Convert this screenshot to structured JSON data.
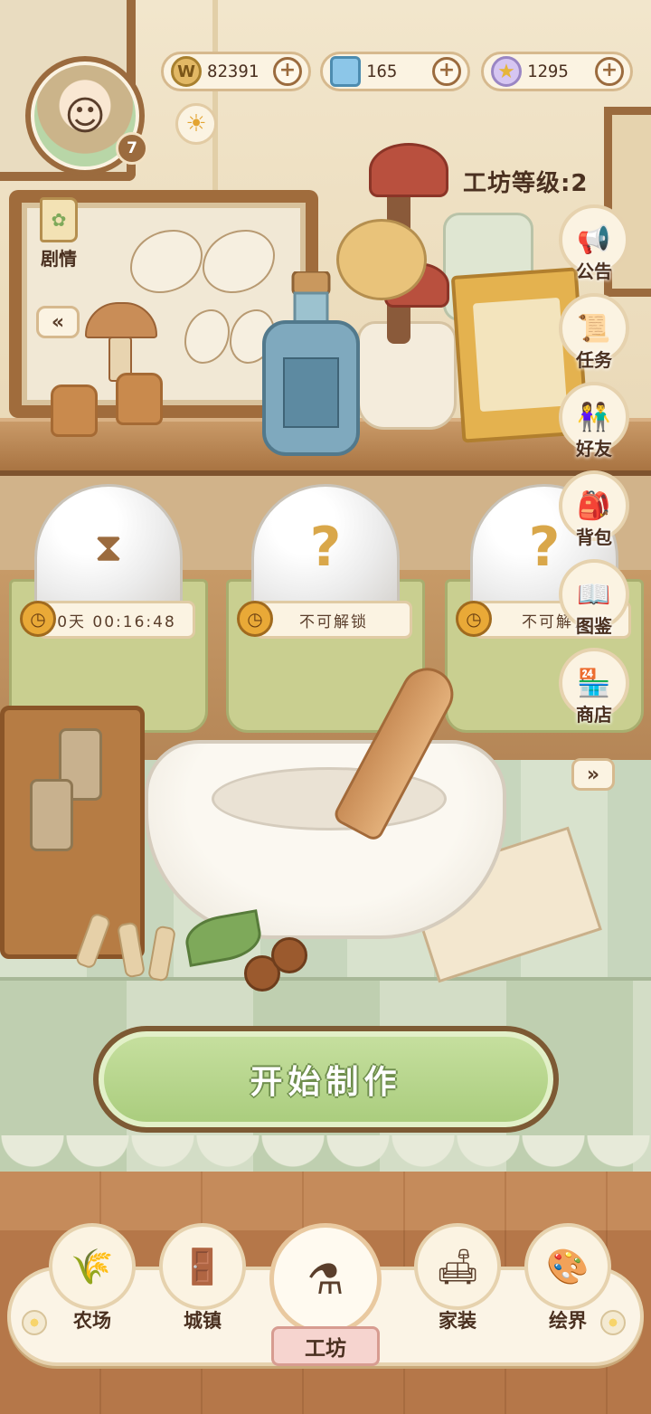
{
  "resources": {
    "coins": {
      "value": "82391",
      "icon": "coin-icon",
      "color": "#e2b865"
    },
    "gems": {
      "value": "165",
      "icon": "crystal-icon",
      "color": "#8cc6e8"
    },
    "stars": {
      "value": "1295",
      "icon": "star-icon",
      "color": "#d6c6f2"
    },
    "plus_label": "+"
  },
  "player": {
    "level": "7",
    "avatar_icon": "player-avatar-icon"
  },
  "story": {
    "label": "剧情"
  },
  "workshop": {
    "level_text": "工坊等级:2"
  },
  "slots": [
    {
      "state": "in-progress",
      "timer": "0天 00:16:48",
      "icon": "hourglass-icon"
    },
    {
      "state": "locked",
      "timer": "不可解锁",
      "icon": "question-icon"
    },
    {
      "state": "locked",
      "timer": "不可解锁",
      "icon": "question-icon"
    }
  ],
  "side_menu": [
    {
      "label": "公告",
      "icon": "megaphone-icon"
    },
    {
      "label": "任务",
      "icon": "scroll-icon"
    },
    {
      "label": "好友",
      "icon": "friends-icon"
    },
    {
      "label": "背包",
      "icon": "backpack-icon"
    },
    {
      "label": "图鉴",
      "icon": "book-icon"
    },
    {
      "label": "商店",
      "icon": "shop-icon"
    }
  ],
  "start_button": {
    "label": "开始制作",
    "color": "#a9cc7c"
  },
  "bottom_nav": [
    {
      "label": "农场",
      "icon": "farm-icon"
    },
    {
      "label": "城镇",
      "icon": "town-icon"
    },
    {
      "label": "工坊",
      "icon": "workshop-icon",
      "active": true
    },
    {
      "label": "家装",
      "icon": "furniture-icon"
    },
    {
      "label": "绘界",
      "icon": "easel-icon"
    }
  ],
  "glyphs": {
    "collapse": "«",
    "expand": "»",
    "hourglass": "⧗",
    "question": "?",
    "sun": "☀",
    "stopwatch": "◷"
  }
}
